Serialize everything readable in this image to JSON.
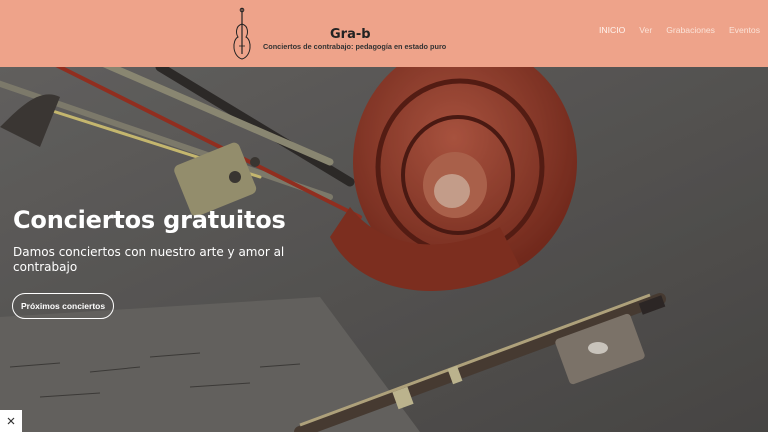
{
  "site": {
    "title": "Gra-b",
    "tagline": "Conciertos de contrabajo: pedagogía en estado puro"
  },
  "nav": {
    "items": [
      {
        "label": "INICIO",
        "active": true
      },
      {
        "label": "Ver"
      },
      {
        "label": "Grabaciones"
      },
      {
        "label": "Eventos"
      }
    ]
  },
  "hero": {
    "title": "Conciertos gratuitos",
    "subtitle": "Damos conciertos con nuestro arte y amor al contrabajo",
    "button_label": "Próximos conciertos"
  },
  "colors": {
    "header_bg": "#eea38a",
    "hero_overlay": "#5d5b58",
    "scroll_red": "#a8371f"
  },
  "icons": {
    "logo": "double-bass-icon",
    "close": "close-icon"
  }
}
